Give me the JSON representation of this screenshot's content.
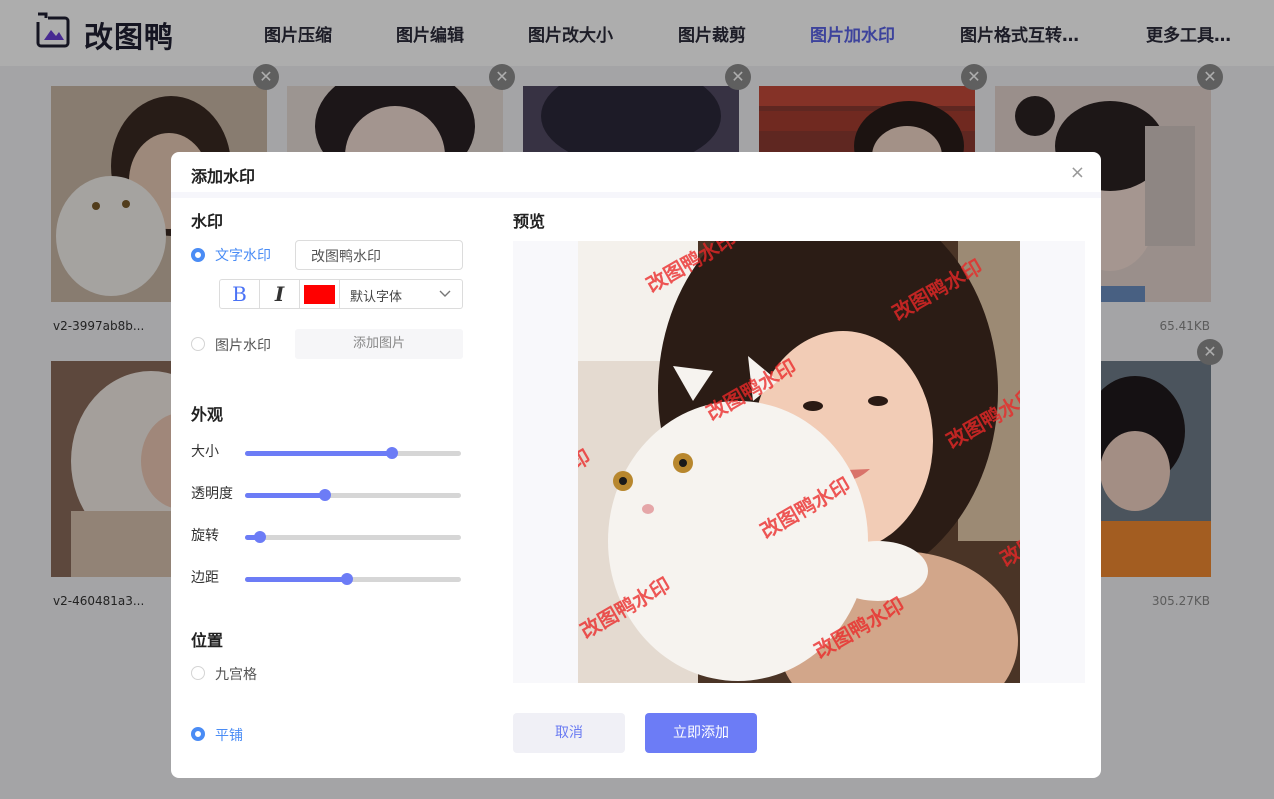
{
  "header": {
    "logo_text": "改图鸭",
    "nav": [
      "图片压缩",
      "图片编辑",
      "图片改大小",
      "图片裁剪",
      "图片加水印",
      "图片格式互转…",
      "更多工具…"
    ],
    "active_index": 4
  },
  "gallery": {
    "row1_first_name": "v2-3997ab8b...",
    "row1_last_size": "65.41KB",
    "row2_first_name": "v2-460481a3...",
    "row2_last_size": "305.27KB",
    "close_symbol": "✕"
  },
  "modal": {
    "title": "添加水印",
    "close_symbol": "×",
    "watermark_section": "水印",
    "text_watermark_label": "文字水印",
    "text_watermark_value": "改图鸭水印",
    "bold_label": "B",
    "italic_label": "I",
    "font_color": "#ff0000",
    "font_name": "默认字体",
    "image_watermark_label": "图片水印",
    "add_image_label": "添加图片",
    "appearance_section": "外观",
    "sliders": [
      {
        "label": "大小",
        "value": 0.68
      },
      {
        "label": "透明度",
        "value": 0.37
      },
      {
        "label": "旋转",
        "value": 0.07
      },
      {
        "label": "边距",
        "value": 0.47
      }
    ],
    "position_section": "位置",
    "grid_label": "九宫格",
    "tile_label": "平铺",
    "preview_title": "预览",
    "watermark_text": "改图鸭水印",
    "cancel_label": "取消",
    "confirm_label": "立即添加"
  },
  "colors": {
    "accent": "#6c7cf6",
    "radio_checked": "#4a8cf5",
    "watermark": "#eb2828"
  }
}
